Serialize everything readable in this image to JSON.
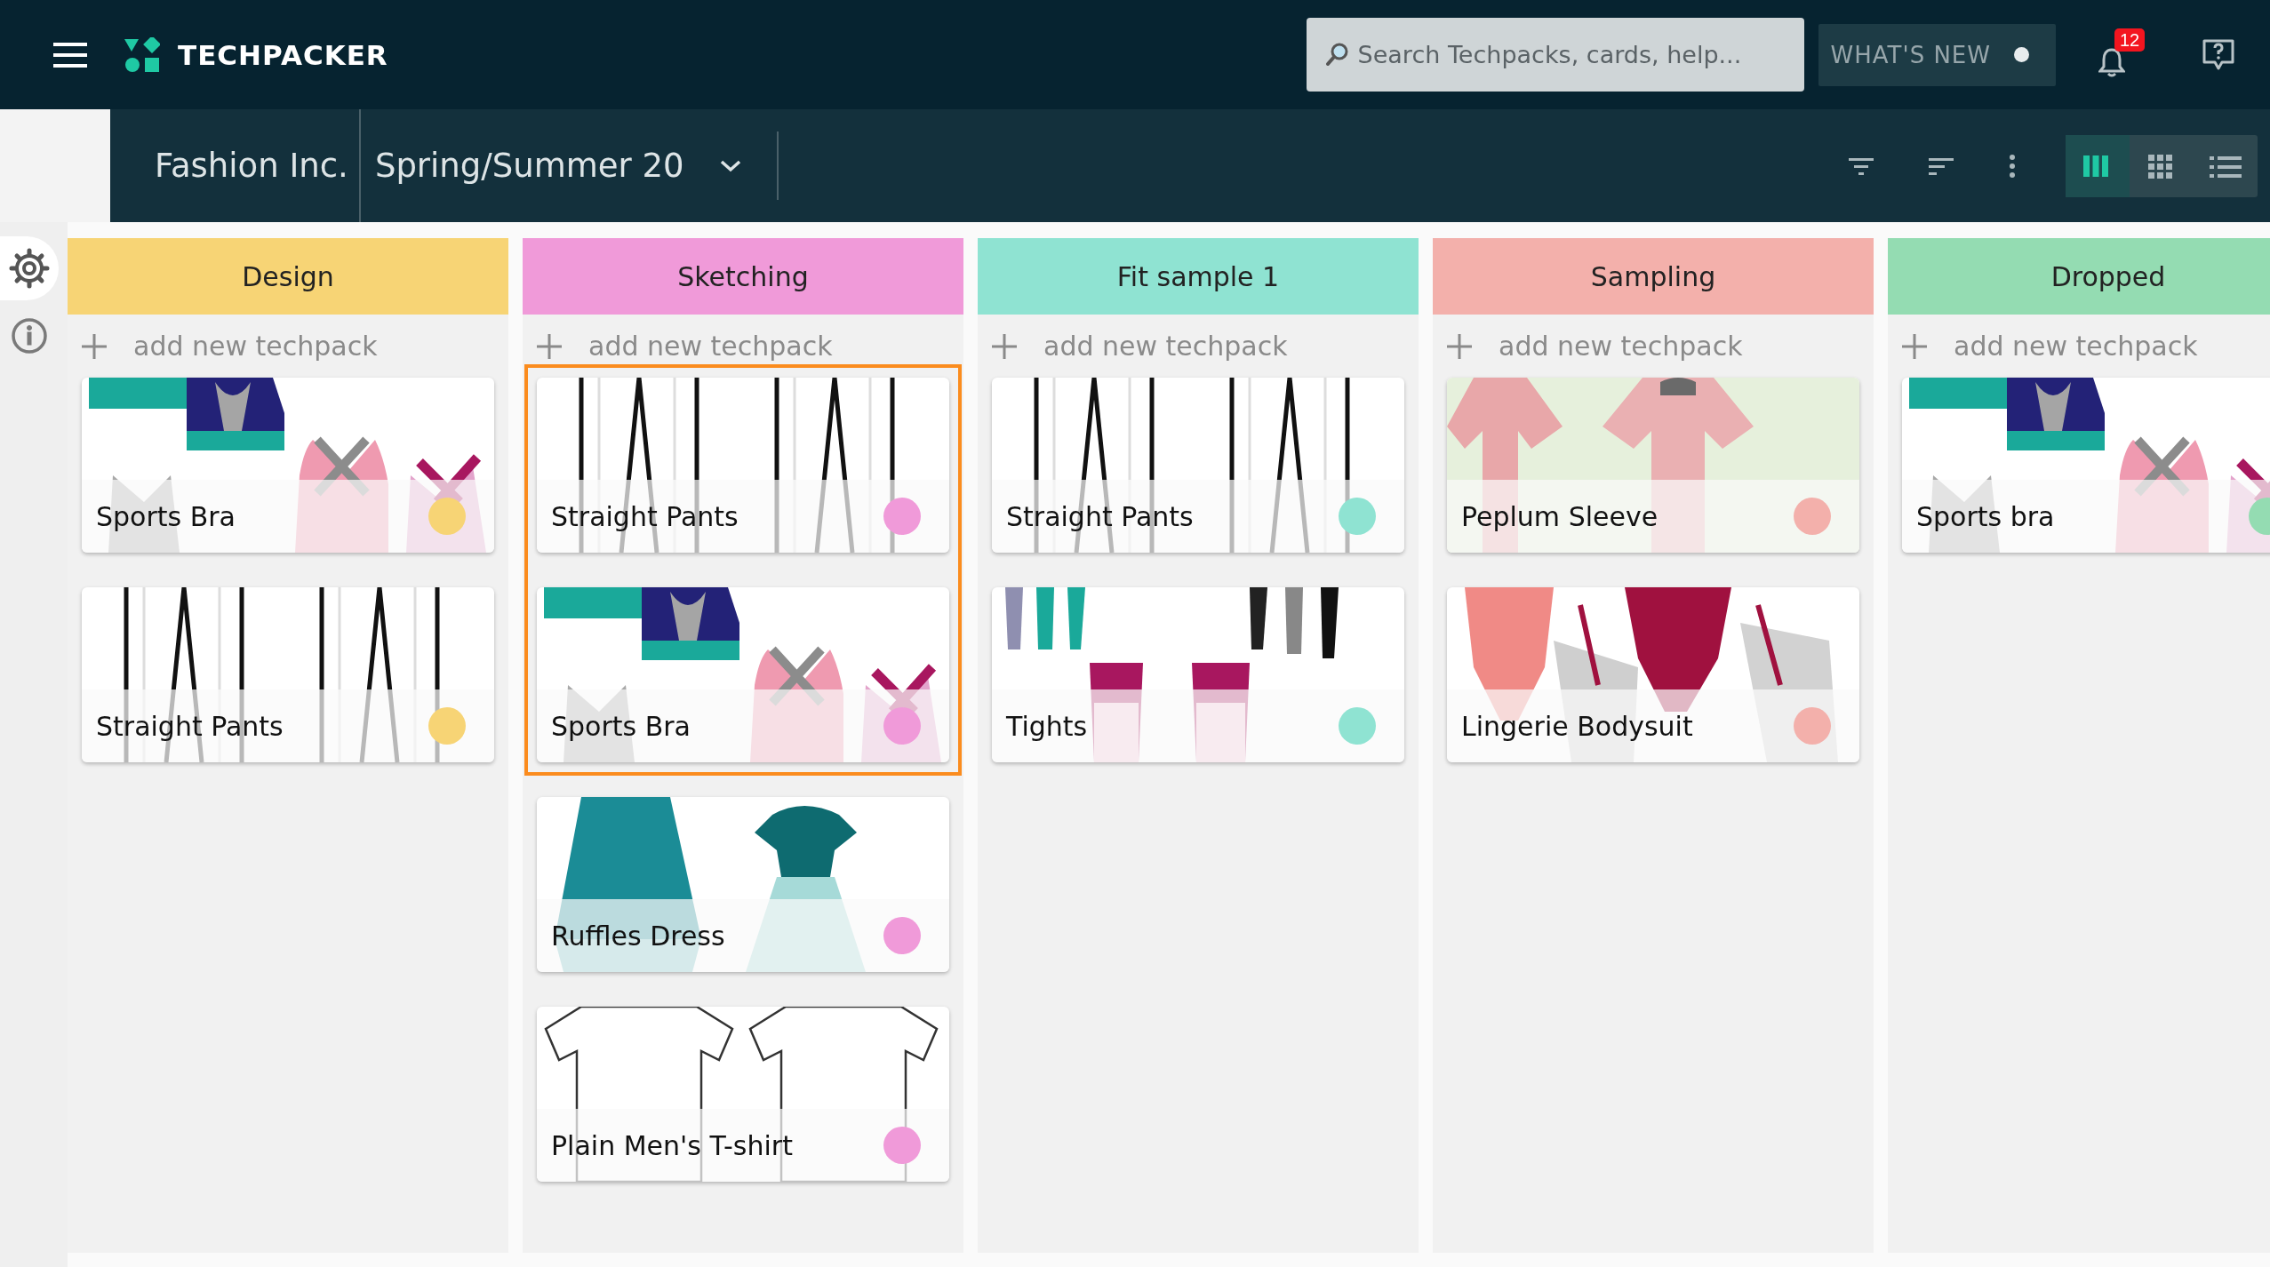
{
  "topbar": {
    "logo": "TECHPACKER",
    "search": {
      "placeholder": "Search Techpacks, cards, help..."
    },
    "whats_new": {
      "label": "WHAT'S NEW",
      "unread": true
    },
    "notifications": {
      "count": "12"
    }
  },
  "breadcrumb": {
    "company": "Fashion Inc.",
    "season": "Spring/Summer 20"
  },
  "views": [
    {
      "kind": "columns",
      "selected": true
    },
    {
      "kind": "grid",
      "selected": false
    },
    {
      "kind": "list",
      "selected": false
    }
  ],
  "rail": [
    {
      "kind": "settings",
      "selected": true
    },
    {
      "kind": "info",
      "selected": false
    }
  ],
  "columns": [
    {
      "title": "Design",
      "color": "#f7d475",
      "add_label": "add new techpack",
      "cards": [
        {
          "title": "Sports Bra",
          "color": "#f7d475",
          "selected": false
        },
        {
          "title": "Straight Pants",
          "color": "#f7d475",
          "selected": false
        }
      ]
    },
    {
      "title": "Sketching",
      "color": "#f09ad9",
      "add_label": "add new techpack",
      "cards": [
        {
          "title": "Straight Pants",
          "color": "#f09ad9",
          "selected": true
        },
        {
          "title": "Sports Bra",
          "color": "#f09ad9",
          "selected": true
        },
        {
          "title": "Ruffles Dress",
          "color": "#f09ad9",
          "selected": false
        },
        {
          "title": "Plain Men's T-shirt",
          "color": "#f09ad9",
          "selected": false
        }
      ]
    },
    {
      "title": "Fit sample 1",
      "color": "#8fe3d2",
      "add_label": "add new techpack",
      "cards": [
        {
          "title": "Straight Pants",
          "color": "#8fe3d2",
          "selected": false
        },
        {
          "title": "Tights",
          "color": "#8fe3d2",
          "selected": false
        }
      ]
    },
    {
      "title": "Sampling",
      "color": "#f3b0ab",
      "add_label": "add new techpack",
      "cards": [
        {
          "title": "Peplum Sleeve",
          "color": "#f3b0ab",
          "selected": false
        },
        {
          "title": "Lingerie Bodysuit",
          "color": "#f3b0ab",
          "selected": false
        }
      ]
    },
    {
      "title": "Dropped",
      "color": "#94dcb2",
      "add_label": "add new techpack",
      "cards": [
        {
          "title": "Sports bra",
          "color": "#94dcb2",
          "selected": false
        }
      ]
    }
  ]
}
